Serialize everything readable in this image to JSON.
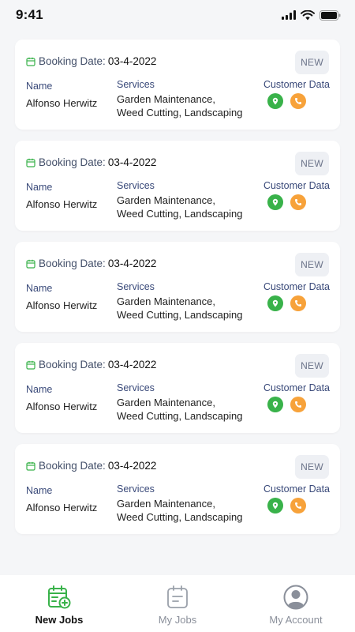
{
  "status_bar": {
    "time": "9:41"
  },
  "jobs": [
    {
      "booking_label": "Booking Date:",
      "booking_date": "03-4-2022",
      "badge": "NEW",
      "name_label": "Name",
      "name": "Alfonso Herwitz",
      "services_label": "Services",
      "services_line1": "Garden Maintenance,",
      "services_line2": "Weed Cutting, Landscaping",
      "customer_label": "Customer Data"
    },
    {
      "booking_label": "Booking Date:",
      "booking_date": "03-4-2022",
      "badge": "NEW",
      "name_label": "Name",
      "name": "Alfonso Herwitz",
      "services_label": "Services",
      "services_line1": "Garden Maintenance,",
      "services_line2": "Weed Cutting, Landscaping",
      "customer_label": "Customer Data"
    },
    {
      "booking_label": "Booking Date:",
      "booking_date": "03-4-2022",
      "badge": "NEW",
      "name_label": "Name",
      "name": "Alfonso Herwitz",
      "services_label": "Services",
      "services_line1": "Garden Maintenance,",
      "services_line2": "Weed Cutting, Landscaping",
      "customer_label": "Customer Data"
    },
    {
      "booking_label": "Booking Date:",
      "booking_date": "03-4-2022",
      "badge": "NEW",
      "name_label": "Name",
      "name": "Alfonso Herwitz",
      "services_label": "Services",
      "services_line1": "Garden Maintenance,",
      "services_line2": "Weed Cutting, Landscaping",
      "customer_label": "Customer Data"
    },
    {
      "booking_label": "Booking Date:",
      "booking_date": "03-4-2022",
      "badge": "NEW",
      "name_label": "Name",
      "name": "Alfonso Herwitz",
      "services_label": "Services",
      "services_line1": "Garden Maintenance,",
      "services_line2": "Weed Cutting, Landscaping",
      "customer_label": "Customer Data"
    }
  ],
  "bottom_nav": {
    "new_jobs": "New Jobs",
    "my_jobs": "My Jobs",
    "my_account": "My Account",
    "active": "new_jobs"
  },
  "colors": {
    "accent_green": "#39b24a",
    "accent_orange": "#f7a23a",
    "label_blue": "#3a4a7a"
  },
  "icons": {
    "calendar": "calendar-icon",
    "location": "location-pin-icon",
    "phone": "phone-icon",
    "new_jobs": "calendar-add-icon",
    "my_jobs": "clipboard-icon",
    "my_account": "user-circle-icon"
  }
}
